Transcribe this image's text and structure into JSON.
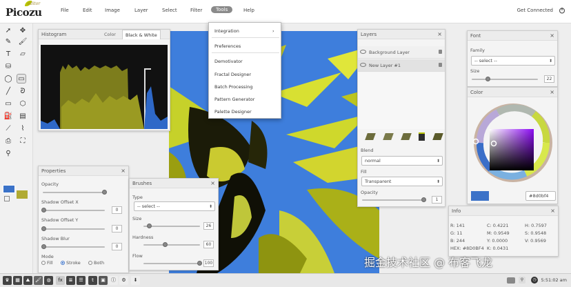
{
  "app": {
    "logo_text": "Picozu",
    "logo_badge": "editor"
  },
  "menu": [
    "File",
    "Edit",
    "Image",
    "Layer",
    "Select",
    "Filter",
    "Tools",
    "Help"
  ],
  "header_right": {
    "get_connected": "Get Connected"
  },
  "tools_menu": {
    "items": [
      "Integration",
      "Preferences",
      "Demotivator",
      "Fractal Designer",
      "Batch Processing",
      "Pattern Generator",
      "Palette Designer"
    ],
    "submenu_arrow": "›"
  },
  "histogram": {
    "title": "Histogram",
    "tabs": [
      "Color",
      "Black & White"
    ]
  },
  "properties": {
    "title": "Properties",
    "opacity_label": "Opacity",
    "opacity_value": "",
    "shadow_offset_x_label": "Shadow Offset X",
    "shadow_offset_x_value": "0",
    "shadow_offset_y_label": "Shadow Offset Y",
    "shadow_offset_y_value": "0",
    "shadow_blur_label": "Shadow Blur",
    "shadow_blur_value": "0",
    "mode_label": "Mode",
    "mode_options": [
      "Fill",
      "Stroke",
      "Both"
    ],
    "mode_selected": "Stroke"
  },
  "brushes": {
    "title": "Brushes",
    "type_label": "Type",
    "type_value": "-- select --",
    "size_label": "Size",
    "size_value": "26",
    "hardness_label": "Hardness",
    "hardness_value": "60",
    "flow_label": "Flow",
    "flow_value": "100"
  },
  "layers": {
    "title": "Layers",
    "rows": [
      "Background Layer",
      "New Layer #1"
    ],
    "blend_label": "Blend",
    "blend_value": "normal",
    "fill_label": "Fill",
    "fill_value": "Transparent",
    "opacity_label": "Opacity",
    "opacity_value": "1"
  },
  "font": {
    "title": "Font",
    "family_label": "Family",
    "family_value": "-- select --",
    "size_label": "Size",
    "size_value": "22"
  },
  "color": {
    "title": "Color",
    "hex_value": "#8d0bf4",
    "current_color": "#3b72c8"
  },
  "info": {
    "title": "Info",
    "rows": [
      [
        "R: 141",
        "C: 0.4221",
        "H: 0.7597"
      ],
      [
        "G: 11",
        "M: 0.9549",
        "S: 0.9548"
      ],
      [
        "B: 244",
        "Y: 0.0000",
        "V: 0.9569"
      ],
      [
        "HEX: #8D0BF4",
        "K: 0.0431",
        ""
      ]
    ]
  },
  "watermark": "掘金技术社区 @ 布客飞龙",
  "bottom": {
    "icon_labels": [
      "fx",
      "t"
    ],
    "clock": "5:51:02 am"
  }
}
